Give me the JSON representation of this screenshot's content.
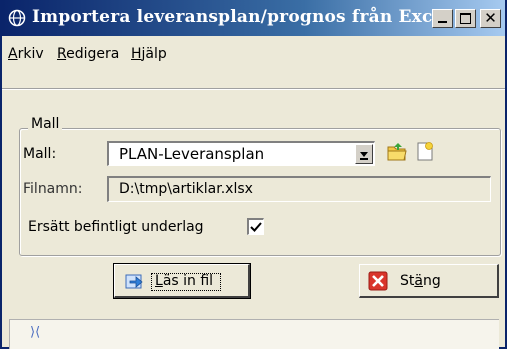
{
  "window": {
    "title": "Importera leveransplan/prognos från Exc...",
    "app_icon": "globe-icon"
  },
  "titlebar_buttons": {
    "minimize_icon": "minimize-icon",
    "maximize_icon": "maximize-icon",
    "close_label": "✕"
  },
  "menu": {
    "items": [
      {
        "prefix": "",
        "underlined": "A",
        "rest": "rkiv"
      },
      {
        "prefix": "",
        "underlined": "R",
        "rest": "edigera"
      },
      {
        "prefix": "",
        "underlined": "H",
        "rest": "jälp"
      }
    ]
  },
  "group": {
    "legend": "Mall",
    "mall_label": "Mall:",
    "mall_value": "PLAN-Leveransplan",
    "filnamn_label": "Filnamn:",
    "filnamn_value": "D:\\tmp\\artiklar.xlsx",
    "replace_label": "Ersätt befintligt underlag",
    "replace_checked": true
  },
  "buttons": {
    "load_underlined": "L",
    "load_rest": "äs in fil",
    "close_prefix": "St",
    "close_underlined": "ä",
    "close_rest": "ng"
  },
  "status": {
    "text": "⟩⟨"
  },
  "colors": {
    "titlebar_start": "#0a246a",
    "titlebar_end": "#a6caf0",
    "face": "#ece9d8",
    "close_red": "#d9352b"
  }
}
